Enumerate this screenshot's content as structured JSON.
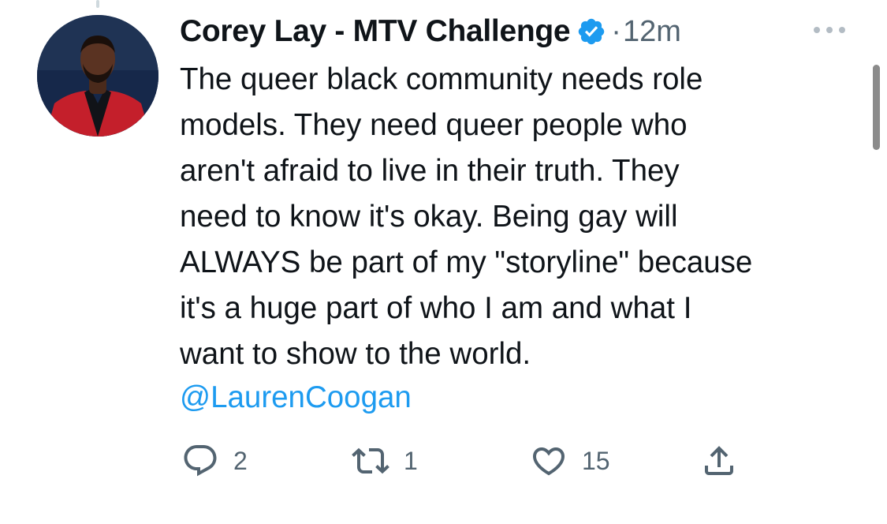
{
  "tweet": {
    "author": {
      "display_name": "Corey Lay - MTV Challenge",
      "verified": true,
      "avatar_icon": "profile-photo"
    },
    "separator": "·",
    "timestamp": "12m",
    "text_lines": [
      "The queer black community needs role",
      "models. They need queer people who",
      "aren't afraid to live in their truth. They",
      "need to know it's okay. Being gay will",
      "ALWAYS be part of my \"storyline\" because",
      "it's a huge part of who I am and what I",
      "want to show to the world."
    ],
    "mention": "@LaurenCoogan",
    "actions": {
      "reply": {
        "icon": "reply-icon",
        "count": "2"
      },
      "retweet": {
        "icon": "retweet-icon",
        "count": "1"
      },
      "like": {
        "icon": "heart-icon",
        "count": "15"
      },
      "share": {
        "icon": "share-icon"
      }
    }
  },
  "colors": {
    "text": "#0f1419",
    "secondary": "#536471",
    "link": "#1d9bf0",
    "verified": "#1d9bf0"
  }
}
